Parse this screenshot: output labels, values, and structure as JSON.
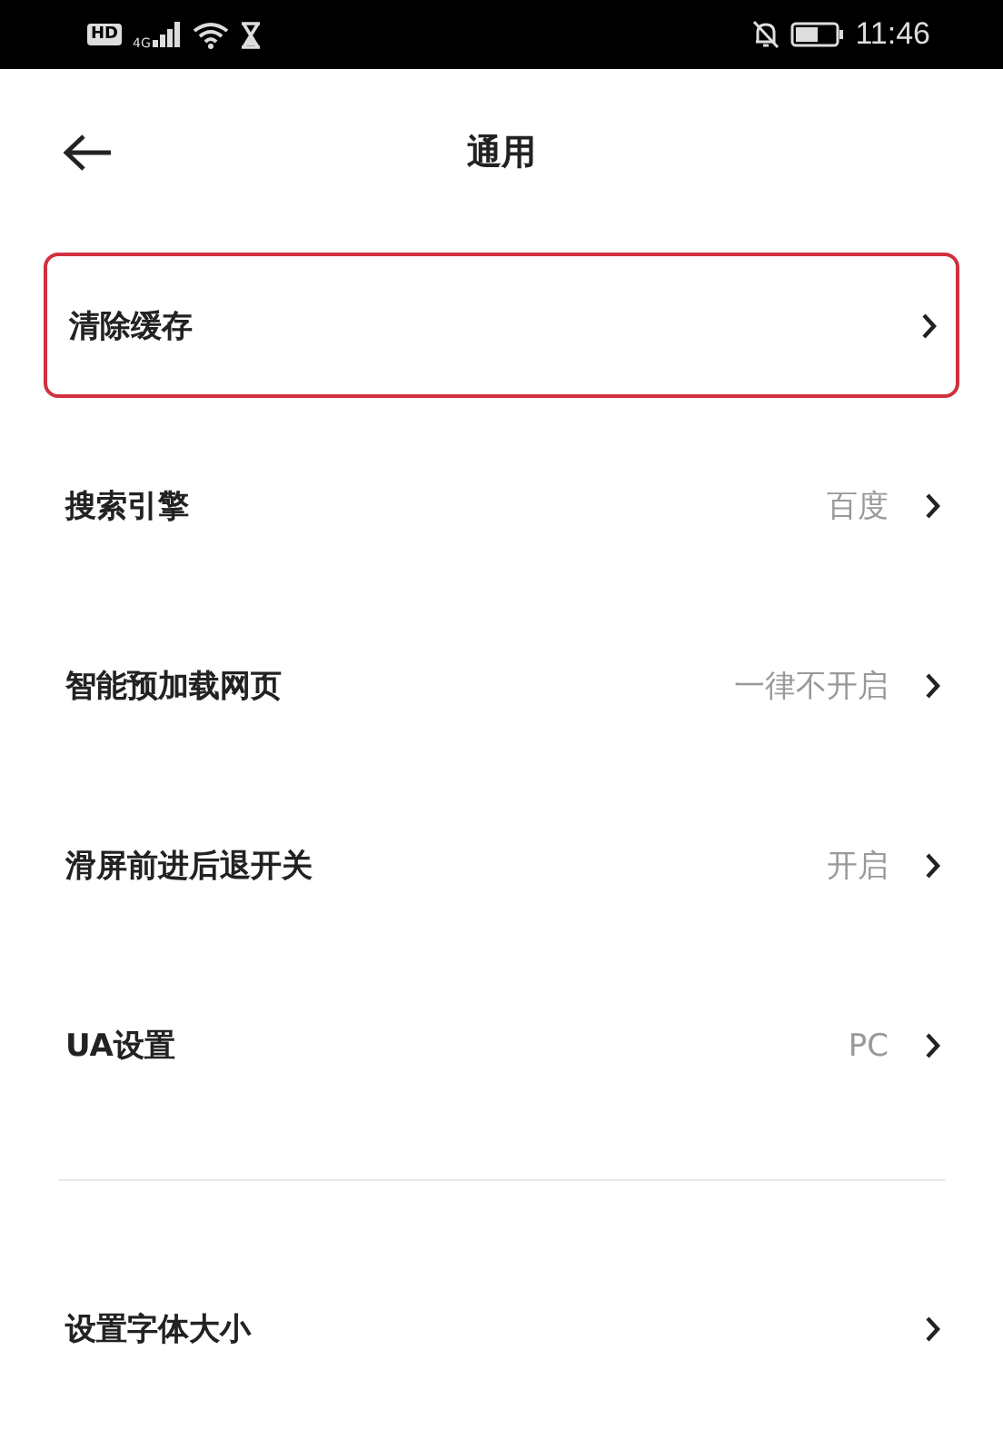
{
  "status_bar": {
    "hd": "HD",
    "network": "4G",
    "time": "11:46"
  },
  "header": {
    "title": "通用"
  },
  "sections": [
    {
      "items": [
        {
          "label": "清除缓存",
          "highlighted": true
        },
        {
          "label": "搜索引擎",
          "value": "百度",
          "highlighted": false
        },
        {
          "label": "智能预加载网页",
          "value": "一律不开启",
          "highlighted": false
        },
        {
          "label": "滑屏前进后退开关",
          "value": "开启",
          "highlighted": false
        },
        {
          "label": "UA设置",
          "value": "PC",
          "highlighted": false
        }
      ]
    },
    {
      "items": [
        {
          "label": "设置字体大小",
          "highlighted": false
        }
      ]
    }
  ]
}
